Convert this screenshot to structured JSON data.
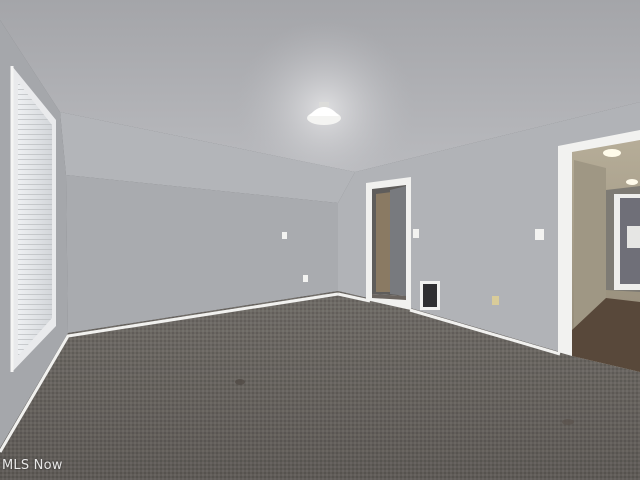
{
  "photo": {
    "subject": "empty-carpeted-bedroom",
    "watermark": "MLS Now",
    "colors": {
      "ceiling": "#b3b4b8",
      "wall_left": "#a9abaf",
      "wall_back": "#aeb0b4",
      "wall_right": "#b1b3b7",
      "carpet": "#6c6864",
      "trim": "#f2f2f0",
      "hallway_floor": "#58483a",
      "hallway_wall": "#a79f8c"
    }
  }
}
